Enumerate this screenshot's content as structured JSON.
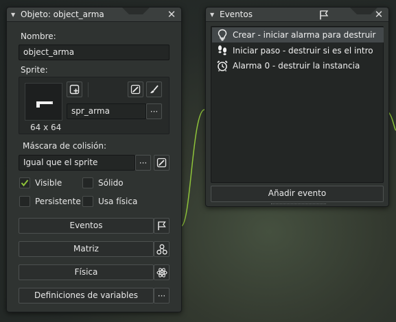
{
  "object_window": {
    "title": "Objeto: object_arma",
    "name_label": "Nombre:",
    "name_value": "object_arma",
    "sprite_label": "Sprite:",
    "sprite_name": "spr_arma",
    "sprite_size": "64 x 64",
    "mask_label": "Máscara de colisión:",
    "mask_value": "Igual que el sprite",
    "checkboxes": [
      {
        "label": "Visible",
        "checked": true
      },
      {
        "label": "Sólido",
        "checked": false
      },
      {
        "label": "Persistente",
        "checked": false
      },
      {
        "label": "Usa física",
        "checked": false
      }
    ],
    "buttons": {
      "eventos": "Eventos",
      "matriz": "Matriz",
      "fisica": "Física",
      "variables": "Definiciones de variables"
    },
    "ellipsis": "···"
  },
  "events_window": {
    "title": "Eventos",
    "events": [
      {
        "icon": "lightbulb-icon",
        "label": "Crear - iniciar alarma para destruir",
        "selected": true
      },
      {
        "icon": "footsteps-icon",
        "label": "Iniciar paso - destruir si es el intro",
        "selected": false
      },
      {
        "icon": "alarm-clock-icon",
        "label": "Alarma 0 - destruir la instancia",
        "selected": false
      }
    ],
    "add_label": "Añadir evento"
  },
  "colors": {
    "accent_green": "#8fc43a",
    "selection": "#43484a"
  }
}
